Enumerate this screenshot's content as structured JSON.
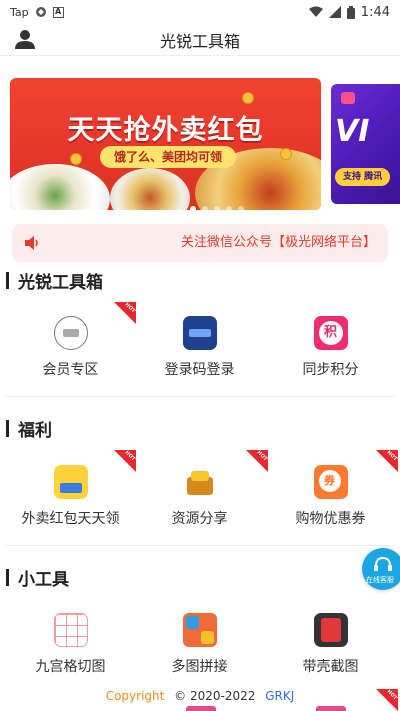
{
  "status_bar": {
    "left_label": "Tap",
    "time": "1:44"
  },
  "header": {
    "title": "光锐工具箱"
  },
  "banner": {
    "headline": "天天抢外卖红包",
    "subline": "饿了么、美团均可领",
    "side_text": "VI",
    "side_pill": "支持 腾讯",
    "slide_count": 5,
    "active_slide": 0
  },
  "notice": {
    "text": "关注微信公众号【极光网络平台】"
  },
  "sections": [
    {
      "title": "光锐工具箱",
      "items": [
        {
          "label": "会员专区",
          "icon": "member-badge-icon",
          "hot": true
        },
        {
          "label": "登录码登录",
          "icon": "login-code-icon",
          "hot": false
        },
        {
          "label": "同步积分",
          "icon": "points-icon",
          "hot": false
        }
      ]
    },
    {
      "title": "福利",
      "items": [
        {
          "label": "外卖红包天天领",
          "icon": "takeout-redpacket-icon",
          "hot": true
        },
        {
          "label": "资源分享",
          "icon": "treasure-chest-icon",
          "hot": true
        },
        {
          "label": "购物优惠券",
          "icon": "coupon-icon",
          "hot": true
        }
      ]
    },
    {
      "title": "小工具",
      "items": [
        {
          "label": "九宫格切图",
          "icon": "nine-grid-icon",
          "hot": false
        },
        {
          "label": "多图拼接",
          "icon": "puzzle-collage-icon",
          "hot": false
        },
        {
          "label": "带壳截图",
          "icon": "phone-frame-screenshot-icon",
          "hot": false
        }
      ]
    }
  ],
  "floating_service": {
    "label": "在线客服"
  },
  "footer": {
    "copyright": "Copyright",
    "years": "© 2020-2022",
    "brand": "GRKJ"
  },
  "colors": {
    "accent_red": "#e8382d",
    "hot_tag": "#e8262c",
    "service_blue": "#1aa6e0",
    "footer_orange": "#f08a1c",
    "footer_blue": "#2f6fd6"
  }
}
